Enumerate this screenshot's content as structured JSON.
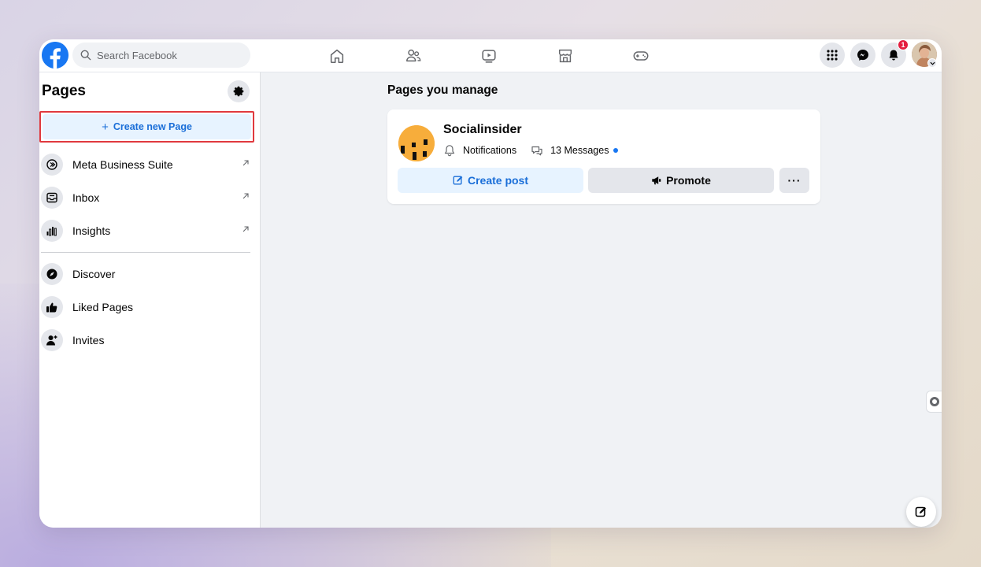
{
  "topbar": {
    "search_placeholder": "Search Facebook",
    "notification_count": "1",
    "nav_icons": [
      "home-icon",
      "friends-icon",
      "watch-icon",
      "marketplace-icon",
      "gaming-icon"
    ]
  },
  "sidebar": {
    "title": "Pages",
    "create_button_label": "Create new Page",
    "items": [
      {
        "label": "Meta Business Suite",
        "icon": "meta-business-suite-icon",
        "external": true
      },
      {
        "label": "Inbox",
        "icon": "inbox-icon",
        "external": true
      },
      {
        "label": "Insights",
        "icon": "insights-icon",
        "external": true
      },
      {
        "label": "Discover",
        "icon": "compass-icon",
        "external": false
      },
      {
        "label": "Liked Pages",
        "icon": "thumbs-up-icon",
        "external": false
      },
      {
        "label": "Invites",
        "icon": "person-add-icon",
        "external": false
      }
    ]
  },
  "main": {
    "title": "Pages you manage",
    "page": {
      "name": "Socialinsider",
      "notifications_label": "Notifications",
      "messages_label": "13 Messages",
      "create_post_label": "Create post",
      "promote_label": "Promote",
      "more_label": "···"
    }
  },
  "colors": {
    "brand_blue": "#1877f2",
    "link_blue": "#1a6ed8",
    "highlight_red": "#e0393e",
    "page_logo": "#f7ad3b"
  }
}
